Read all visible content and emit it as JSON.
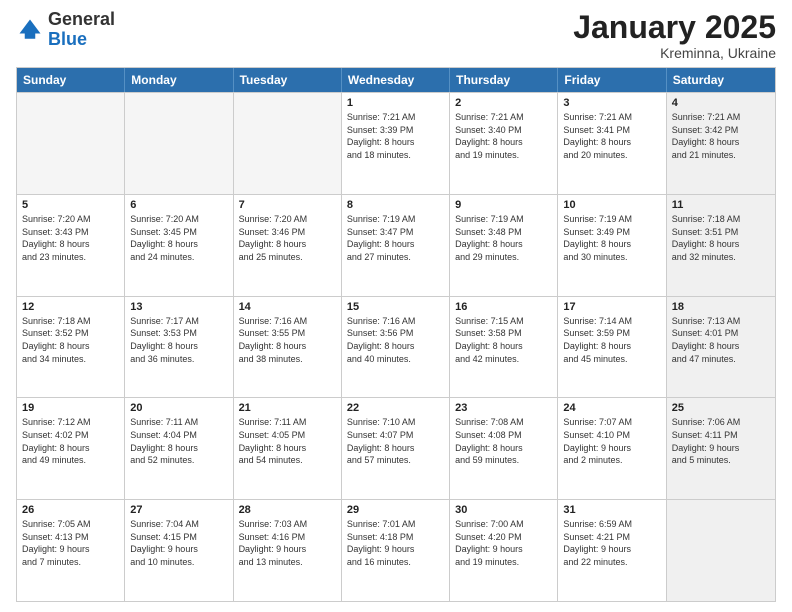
{
  "header": {
    "logo_general": "General",
    "logo_blue": "Blue",
    "month_title": "January 2025",
    "location": "Kreminna, Ukraine"
  },
  "weekdays": [
    "Sunday",
    "Monday",
    "Tuesday",
    "Wednesday",
    "Thursday",
    "Friday",
    "Saturday"
  ],
  "rows": [
    [
      {
        "day": "",
        "empty": true
      },
      {
        "day": "",
        "empty": true
      },
      {
        "day": "",
        "empty": true
      },
      {
        "day": "1",
        "info": "Sunrise: 7:21 AM\nSunset: 3:39 PM\nDaylight: 8 hours\nand 18 minutes."
      },
      {
        "day": "2",
        "info": "Sunrise: 7:21 AM\nSunset: 3:40 PM\nDaylight: 8 hours\nand 19 minutes."
      },
      {
        "day": "3",
        "info": "Sunrise: 7:21 AM\nSunset: 3:41 PM\nDaylight: 8 hours\nand 20 minutes."
      },
      {
        "day": "4",
        "info": "Sunrise: 7:21 AM\nSunset: 3:42 PM\nDaylight: 8 hours\nand 21 minutes.",
        "shaded": true
      }
    ],
    [
      {
        "day": "5",
        "info": "Sunrise: 7:20 AM\nSunset: 3:43 PM\nDaylight: 8 hours\nand 23 minutes."
      },
      {
        "day": "6",
        "info": "Sunrise: 7:20 AM\nSunset: 3:45 PM\nDaylight: 8 hours\nand 24 minutes."
      },
      {
        "day": "7",
        "info": "Sunrise: 7:20 AM\nSunset: 3:46 PM\nDaylight: 8 hours\nand 25 minutes."
      },
      {
        "day": "8",
        "info": "Sunrise: 7:19 AM\nSunset: 3:47 PM\nDaylight: 8 hours\nand 27 minutes."
      },
      {
        "day": "9",
        "info": "Sunrise: 7:19 AM\nSunset: 3:48 PM\nDaylight: 8 hours\nand 29 minutes."
      },
      {
        "day": "10",
        "info": "Sunrise: 7:19 AM\nSunset: 3:49 PM\nDaylight: 8 hours\nand 30 minutes."
      },
      {
        "day": "11",
        "info": "Sunrise: 7:18 AM\nSunset: 3:51 PM\nDaylight: 8 hours\nand 32 minutes.",
        "shaded": true
      }
    ],
    [
      {
        "day": "12",
        "info": "Sunrise: 7:18 AM\nSunset: 3:52 PM\nDaylight: 8 hours\nand 34 minutes."
      },
      {
        "day": "13",
        "info": "Sunrise: 7:17 AM\nSunset: 3:53 PM\nDaylight: 8 hours\nand 36 minutes."
      },
      {
        "day": "14",
        "info": "Sunrise: 7:16 AM\nSunset: 3:55 PM\nDaylight: 8 hours\nand 38 minutes."
      },
      {
        "day": "15",
        "info": "Sunrise: 7:16 AM\nSunset: 3:56 PM\nDaylight: 8 hours\nand 40 minutes."
      },
      {
        "day": "16",
        "info": "Sunrise: 7:15 AM\nSunset: 3:58 PM\nDaylight: 8 hours\nand 42 minutes."
      },
      {
        "day": "17",
        "info": "Sunrise: 7:14 AM\nSunset: 3:59 PM\nDaylight: 8 hours\nand 45 minutes."
      },
      {
        "day": "18",
        "info": "Sunrise: 7:13 AM\nSunset: 4:01 PM\nDaylight: 8 hours\nand 47 minutes.",
        "shaded": true
      }
    ],
    [
      {
        "day": "19",
        "info": "Sunrise: 7:12 AM\nSunset: 4:02 PM\nDaylight: 8 hours\nand 49 minutes."
      },
      {
        "day": "20",
        "info": "Sunrise: 7:11 AM\nSunset: 4:04 PM\nDaylight: 8 hours\nand 52 minutes."
      },
      {
        "day": "21",
        "info": "Sunrise: 7:11 AM\nSunset: 4:05 PM\nDaylight: 8 hours\nand 54 minutes."
      },
      {
        "day": "22",
        "info": "Sunrise: 7:10 AM\nSunset: 4:07 PM\nDaylight: 8 hours\nand 57 minutes."
      },
      {
        "day": "23",
        "info": "Sunrise: 7:08 AM\nSunset: 4:08 PM\nDaylight: 8 hours\nand 59 minutes."
      },
      {
        "day": "24",
        "info": "Sunrise: 7:07 AM\nSunset: 4:10 PM\nDaylight: 9 hours\nand 2 minutes."
      },
      {
        "day": "25",
        "info": "Sunrise: 7:06 AM\nSunset: 4:11 PM\nDaylight: 9 hours\nand 5 minutes.",
        "shaded": true
      }
    ],
    [
      {
        "day": "26",
        "info": "Sunrise: 7:05 AM\nSunset: 4:13 PM\nDaylight: 9 hours\nand 7 minutes."
      },
      {
        "day": "27",
        "info": "Sunrise: 7:04 AM\nSunset: 4:15 PM\nDaylight: 9 hours\nand 10 minutes."
      },
      {
        "day": "28",
        "info": "Sunrise: 7:03 AM\nSunset: 4:16 PM\nDaylight: 9 hours\nand 13 minutes."
      },
      {
        "day": "29",
        "info": "Sunrise: 7:01 AM\nSunset: 4:18 PM\nDaylight: 9 hours\nand 16 minutes."
      },
      {
        "day": "30",
        "info": "Sunrise: 7:00 AM\nSunset: 4:20 PM\nDaylight: 9 hours\nand 19 minutes."
      },
      {
        "day": "31",
        "info": "Sunrise: 6:59 AM\nSunset: 4:21 PM\nDaylight: 9 hours\nand 22 minutes."
      },
      {
        "day": "",
        "empty": true,
        "shaded": true
      }
    ]
  ]
}
